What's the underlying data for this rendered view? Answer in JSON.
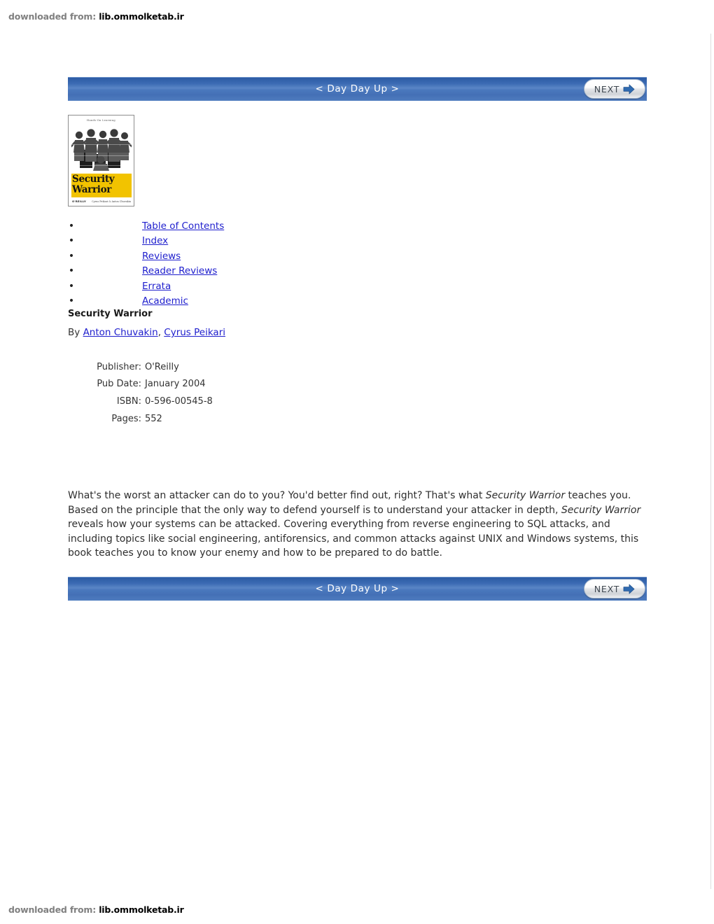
{
  "watermark": {
    "prefix": "downloaded from:",
    "site": "lib.ommolketab.ir"
  },
  "nav": {
    "label": "< Day Day Up >",
    "next_label": "NEXT",
    "next_icon": "arrow-right-icon"
  },
  "cover": {
    "caption": "Hands-On Learning",
    "title_line1": "Security",
    "title_line2": "Warrior",
    "publisher_logo": "O'REILLY",
    "authors_small": "Cyrus Peikari & Anton Chuvakin",
    "band_color": "#f2c300"
  },
  "links": [
    {
      "label": "Table of Contents",
      "bullet": "•"
    },
    {
      "label": "Index",
      "bullet": "•"
    },
    {
      "label": "Reviews",
      "bullet": "•"
    },
    {
      "label": "Reader Reviews",
      "bullet": "•"
    },
    {
      "label": "Errata",
      "bullet": "•"
    },
    {
      "label": "Academic",
      "bullet": "•"
    }
  ],
  "book": {
    "title": "Security Warrior",
    "by_label": "By",
    "author1": "Anton Chuvakin",
    "author_separator": ",",
    "author2": "Cyrus Peikari"
  },
  "meta": [
    {
      "label": "Publisher:",
      "value": "O'Reilly"
    },
    {
      "label": "Pub Date:",
      "value": "January 2004"
    },
    {
      "label": "ISBN:",
      "value": "0-596-00545-8"
    },
    {
      "label": "Pages:",
      "value": "552"
    }
  ],
  "description": {
    "part1": "What's the worst an attacker can do to you? You'd better find out, right? That's what ",
    "em1": "Security Warrior",
    "part2": " teaches you. Based on the principle that the only way to defend yourself is to understand your attacker in depth, ",
    "em2": "Security Warrior",
    "part3": " reveals how your systems can be attacked. Covering everything from reverse engineering to SQL attacks, and including topics like social engineering, antiforensics, and common attacks against UNIX and Windows systems, this book teaches you to know your enemy and how to be prepared to do battle."
  },
  "colors": {
    "link": "#1e1ecd",
    "nav_blue": "#4470b6",
    "watermark_gray": "#808080"
  }
}
